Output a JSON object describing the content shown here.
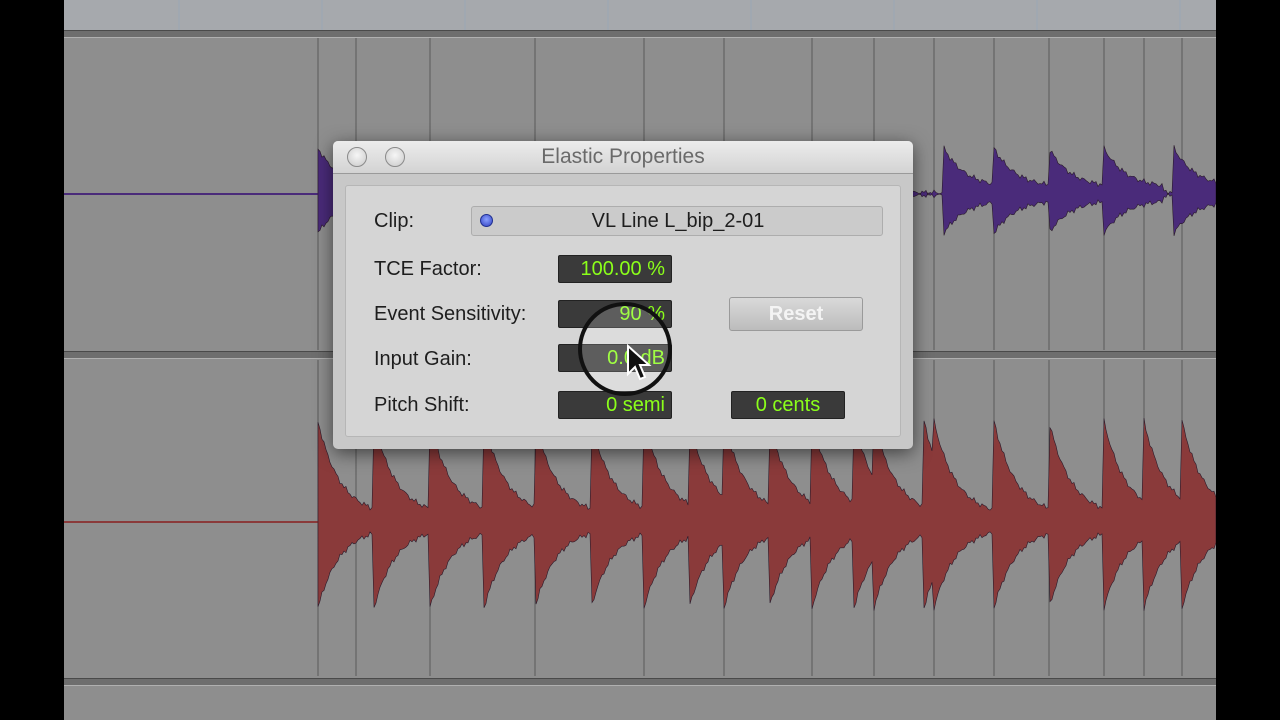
{
  "window": {
    "title": "Elastic Properties"
  },
  "clip": {
    "label": "Clip:",
    "name": "VL Line L_bip_2-01"
  },
  "tce_factor": {
    "label": "TCE Factor:",
    "value": "100.00 %"
  },
  "event_sensitivity": {
    "label": "Event Sensitivity:",
    "value": "90 %"
  },
  "input_gain": {
    "label": "Input Gain:",
    "value": "0.0 dB"
  },
  "pitch_shift": {
    "label": "Pitch Shift:",
    "semitones": "0 semi",
    "cents": "0 cents"
  },
  "reset_button": {
    "label": "Reset"
  },
  "colors": {
    "field_text": "#8bff1a",
    "purple_waveform": "#4a2b7a",
    "red_waveform": "#8a3a3a",
    "background": "#8e8e8e"
  },
  "icons": {
    "clip_indicator": "clip-color-dot-icon",
    "close": "close-icon",
    "minimize": "minimize-icon",
    "cursor": "mouse-pointer-icon"
  }
}
